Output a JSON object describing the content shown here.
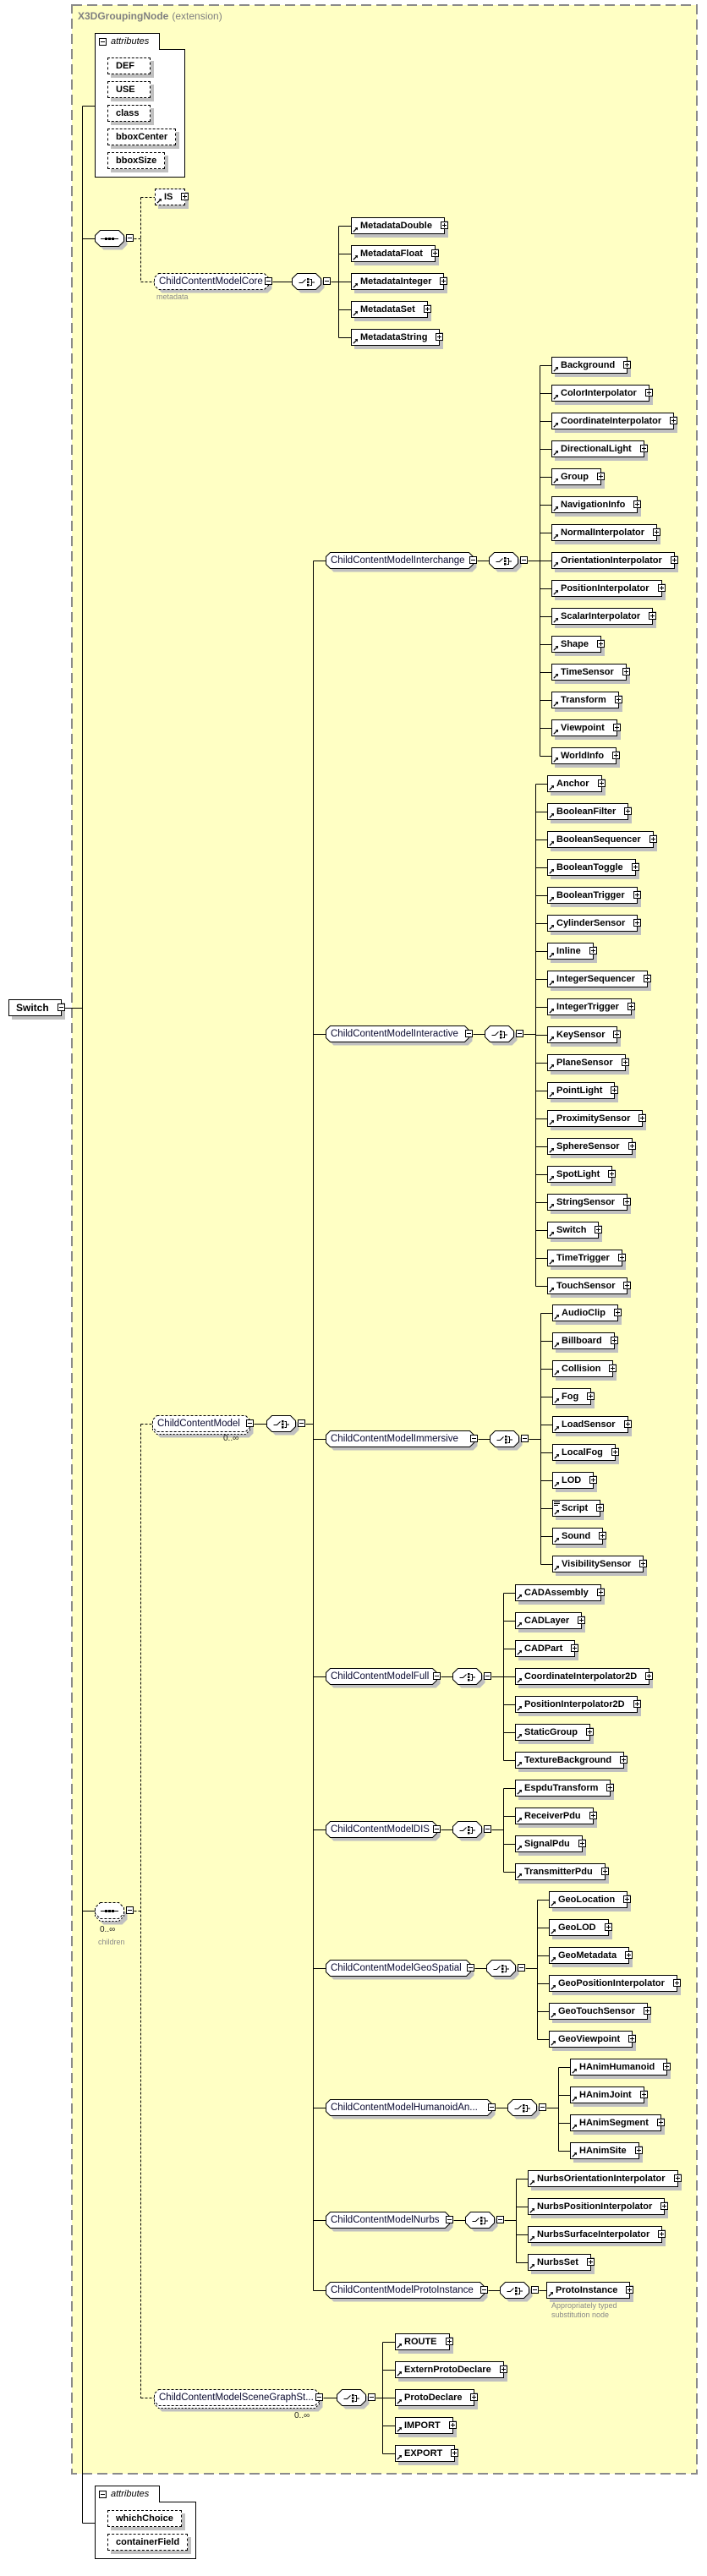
{
  "diagram": {
    "root": {
      "label": "Switch"
    },
    "extension": {
      "base": "X3DGroupingNode",
      "qualifier": "(extension)"
    },
    "inherited_attributes": {
      "header": "attributes",
      "items": [
        "DEF",
        "USE",
        "class",
        "bboxCenter",
        "bboxSize"
      ]
    },
    "base_sequence": {
      "IS": {
        "label": "IS"
      },
      "core": {
        "label": "ChildContentModelCore",
        "annotation": "metadata",
        "items": [
          "MetadataDouble",
          "MetadataFloat",
          "MetadataInteger",
          "MetadataSet",
          "MetadataString"
        ]
      }
    },
    "children_sequence": {
      "occurrence": "0..∞",
      "annotation": "children",
      "child_content_model": {
        "label": "ChildContentModel",
        "occurrence": "0..∞",
        "groups": [
          {
            "label": "ChildContentModelInterchange",
            "items": [
              "Background",
              "ColorInterpolator",
              "CoordinateInterpolator",
              "DirectionalLight",
              "Group",
              "NavigationInfo",
              "NormalInterpolator",
              "OrientationInterpolator",
              "PositionInterpolator",
              "ScalarInterpolator",
              "Shape",
              "TimeSensor",
              "Transform",
              "Viewpoint",
              "WorldInfo"
            ]
          },
          {
            "label": "ChildContentModelInteractive",
            "items": [
              "Anchor",
              "BooleanFilter",
              "BooleanSequencer",
              "BooleanToggle",
              "BooleanTrigger",
              "CylinderSensor",
              "Inline",
              "IntegerSequencer",
              "IntegerTrigger",
              "KeySensor",
              "PlaneSensor",
              "PointLight",
              "ProximitySensor",
              "SphereSensor",
              "SpotLight",
              "StringSensor",
              "Switch",
              "TimeTrigger",
              "TouchSensor"
            ]
          },
          {
            "label": "ChildContentModelImmersive",
            "items": [
              "AudioClip",
              "Billboard",
              "Collision",
              "Fog",
              "LoadSensor",
              "LocalFog",
              "LOD",
              "Script",
              "Sound",
              "VisibilitySensor"
            ]
          },
          {
            "label": "ChildContentModelFull",
            "items": [
              "CADAssembly",
              "CADLayer",
              "CADPart",
              "CoordinateInterpolator2D",
              "PositionInterpolator2D",
              "StaticGroup",
              "TextureBackground"
            ]
          },
          {
            "label": "ChildContentModelDIS",
            "items": [
              "EspduTransform",
              "ReceiverPdu",
              "SignalPdu",
              "TransmitterPdu"
            ]
          },
          {
            "label": "ChildContentModelGeoSpatial",
            "items": [
              "GeoLocation",
              "GeoLOD",
              "GeoMetadata",
              "GeoPositionInterpolator",
              "GeoTouchSensor",
              "GeoViewpoint"
            ]
          },
          {
            "label": "ChildContentModelHumanoidAn...",
            "items": [
              "HAnimHumanoid",
              "HAnimJoint",
              "HAnimSegment",
              "HAnimSite"
            ]
          },
          {
            "label": "ChildContentModelNurbs",
            "items": [
              "NurbsOrientationInterpolator",
              "NurbsPositionInterpolator",
              "NurbsSurfaceInterpolator",
              "NurbsSet"
            ]
          },
          {
            "label": "ChildContentModelProtoInstance",
            "items": [
              "ProtoInstance"
            ],
            "annotation_lines": [
              "Appropriately typed",
              "substitution node"
            ]
          }
        ]
      },
      "scene_graph_structure": {
        "label": "ChildContentModelSceneGraphSt...",
        "occurrence": "0..∞",
        "items": [
          "ROUTE",
          "ExternProtoDeclare",
          "ProtoDeclare",
          "IMPORT",
          "EXPORT"
        ]
      }
    },
    "own_attributes": {
      "header": "attributes",
      "items": [
        "whichChoice",
        "containerField"
      ]
    },
    "elements_with_documentation": [
      "Script"
    ]
  },
  "icons": {
    "expand": "expand-icon",
    "collapse": "collapse-icon",
    "reference": "reference-arrow-icon",
    "documentation": "documentation-icon",
    "choice": "choice-compositor-icon",
    "sequence": "sequence-compositor-icon"
  },
  "colors": {
    "extension_background": "#FFFFC4",
    "extension_border": "#8A8A8A",
    "shadow": "#C0C0C0",
    "title_text": "#808080",
    "annotation_text": "#8A8A8A"
  }
}
